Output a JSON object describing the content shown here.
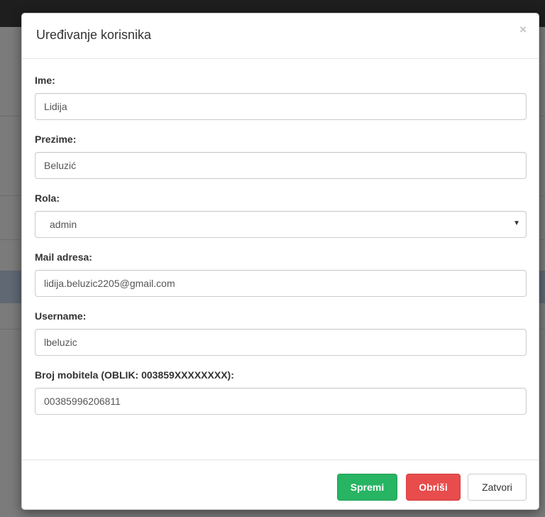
{
  "modal": {
    "title": "Uređivanje korisnika",
    "close_symbol": "×"
  },
  "form": {
    "first_name": {
      "label": "Ime:",
      "value": "Lidija"
    },
    "last_name": {
      "label": "Prezime:",
      "value": "Beluzić"
    },
    "role": {
      "label": "Rola:",
      "selected": "admin"
    },
    "email": {
      "label": "Mail adresa:",
      "value": "lidija.beluzic2205@gmail.com"
    },
    "username": {
      "label": "Username:",
      "value": "lbeluzic"
    },
    "phone": {
      "label": "Broj mobitela (OBLIK: 003859XXXXXXXX):",
      "value": "00385996206811"
    }
  },
  "footer": {
    "save_label": "Spremi",
    "delete_label": "Obriši",
    "close_label": "Zatvori"
  },
  "colors": {
    "save": "#27b463",
    "delete": "#e84c4c"
  }
}
